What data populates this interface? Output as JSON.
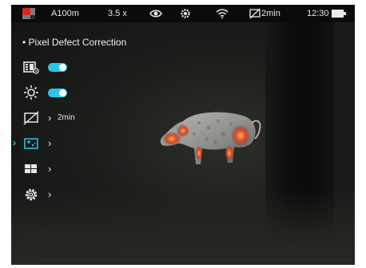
{
  "status_bar": {
    "range": "A100m",
    "zoom": "3.5 x",
    "display_off_timer": "2min",
    "time": "12:30",
    "icons": [
      "logo-icon",
      "eye-icon",
      "gear-icon",
      "wifi-icon",
      "display-off-icon",
      "battery-icon"
    ]
  },
  "menu": {
    "title": "• Pixel Defect Correction",
    "items": [
      {
        "icon": "video-settings-icon",
        "type": "toggle",
        "state": "on"
      },
      {
        "icon": "sun-brightness-icon",
        "type": "toggle",
        "state": "on"
      },
      {
        "icon": "display-off-icon",
        "type": "submenu",
        "value": "2min"
      },
      {
        "icon": "pixel-correction-icon",
        "type": "submenu",
        "selected": true
      },
      {
        "icon": "grid-layout-icon",
        "type": "submenu"
      },
      {
        "icon": "gear-icon",
        "type": "submenu"
      }
    ]
  },
  "colors": {
    "accent": "#2ec5e6",
    "statusbar": "#0b0b0b",
    "text": "#e8e8e8"
  }
}
